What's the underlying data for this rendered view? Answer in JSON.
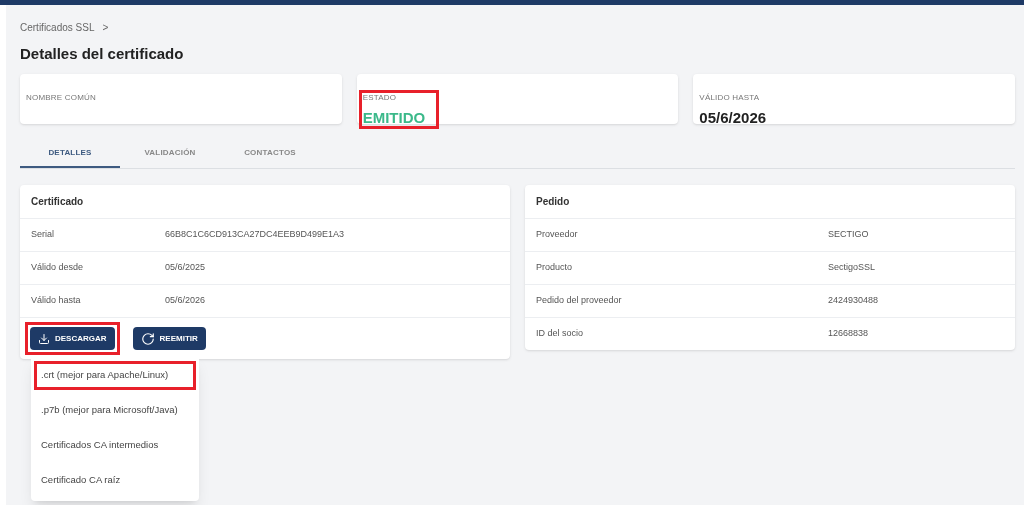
{
  "breadcrumb": {
    "items": [
      "Certificados SSL"
    ],
    "separator": ">"
  },
  "title": "Detalles del certificado",
  "summary_cards": [
    {
      "label": "NOMBRE COMÚN",
      "kind": "blank",
      "highlighted": false
    },
    {
      "label": "ESTADO",
      "value": "EMITIDO",
      "kind": "status",
      "highlighted": true
    },
    {
      "label": "VÁLIDO HASTA",
      "value": "05/6/2026",
      "kind": "plain",
      "highlighted": false
    }
  ],
  "tabs": [
    {
      "label": "DETALLES",
      "selected": true
    },
    {
      "label": "VALIDACIÓN",
      "selected": false
    },
    {
      "label": "CONTACTOS",
      "selected": false
    }
  ],
  "certificate": {
    "title": "Certificado",
    "rows": [
      {
        "label": "Serial",
        "value": "66B8C1C6CD913CA27DC4EEB9D499E1A3"
      },
      {
        "label": "Válido desde",
        "value": "05/6/2025"
      },
      {
        "label": "Válido hasta",
        "value": "05/6/2026"
      }
    ],
    "buttons": [
      {
        "label": "DESCARGAR",
        "kind": "download",
        "highlighted": true
      },
      {
        "label": "REEMITIR",
        "kind": "reissue",
        "highlighted": false
      }
    ]
  },
  "order": {
    "title": "Pedido",
    "rows": [
      {
        "label": "Proveedor",
        "value": "SECTIGO"
      },
      {
        "label": "Producto",
        "value": "SectigoSSL"
      },
      {
        "label": "Pedido del proveedor",
        "value": "2424930488"
      },
      {
        "label": "ID del socio",
        "value": "12668838"
      }
    ]
  },
  "download_menu": [
    {
      "label": ".crt (mejor para Apache/Linux)",
      "highlighted": true
    },
    {
      "label": ".p7b (mejor para Microsoft/Java)",
      "highlighted": false
    },
    {
      "label": "Certificados CA intermedios",
      "highlighted": false
    },
    {
      "label": "Certificado CA raíz",
      "highlighted": false
    }
  ]
}
